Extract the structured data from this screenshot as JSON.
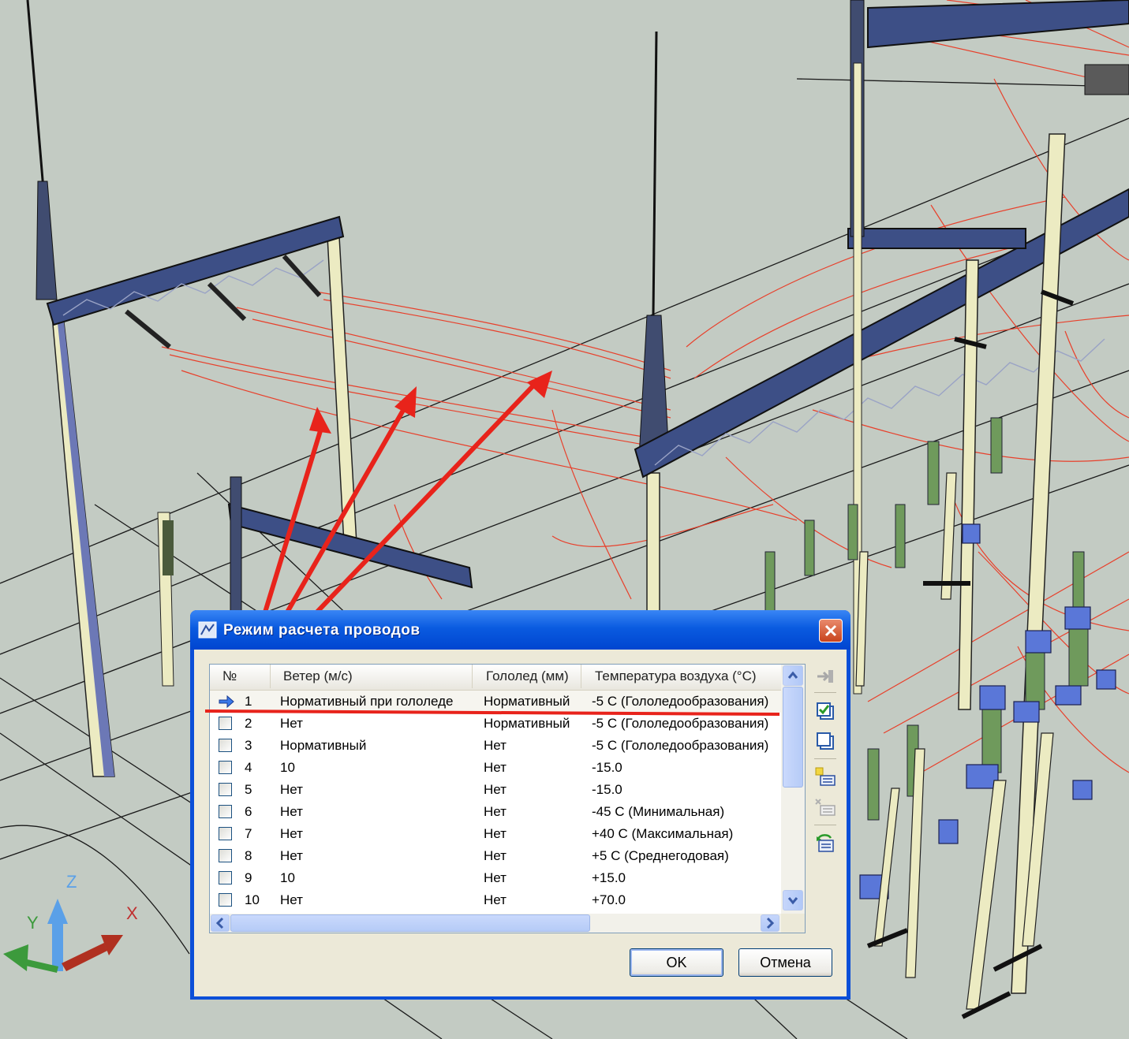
{
  "dialog": {
    "title": "Режим расчета проводов",
    "ok_label": "OK",
    "cancel_label": "Отмена"
  },
  "table": {
    "columns": [
      "№",
      "Ветер (м/с)",
      "Гололед (мм)",
      "Температура воздуха (°C)"
    ],
    "rows": [
      {
        "no": "1",
        "wind": "Нормативный при гололеде",
        "ice": "Нормативный",
        "temp": "-5 C (Гололедообразования)"
      },
      {
        "no": "2",
        "wind": "Нет",
        "ice": "Нормативный",
        "temp": "-5 C (Гололедообразования)"
      },
      {
        "no": "3",
        "wind": "Нормативный",
        "ice": "Нет",
        "temp": "-5 C (Гололедообразования)"
      },
      {
        "no": "4",
        "wind": "10",
        "ice": "Нет",
        "temp": "-15.0"
      },
      {
        "no": "5",
        "wind": "Нет",
        "ice": "Нет",
        "temp": "-15.0"
      },
      {
        "no": "6",
        "wind": "Нет",
        "ice": "Нет",
        "temp": "-45 C (Минимальная)"
      },
      {
        "no": "7",
        "wind": "Нет",
        "ice": "Нет",
        "temp": "+40 C (Максимальная)"
      },
      {
        "no": "8",
        "wind": "Нет",
        "ice": "Нет",
        "temp": "+5 C (Среднегодовая)"
      },
      {
        "no": "9",
        "wind": "10",
        "ice": "Нет",
        "temp": "+15.0"
      },
      {
        "no": "10",
        "wind": "Нет",
        "ice": "Нет",
        "temp": "+70.0"
      }
    ]
  },
  "axes": {
    "x": "X",
    "y": "Y",
    "z": "Z"
  },
  "colors": {
    "background": "#c3cbc3",
    "annotation_red": "#e8231b",
    "wire_red": "#e8402b",
    "steel_blue": "#3d4f86",
    "title_blue": "#0a5be0"
  },
  "icons": {
    "title": "app-icon",
    "close": "close-icon",
    "current_row": "arrow-right-icon"
  }
}
